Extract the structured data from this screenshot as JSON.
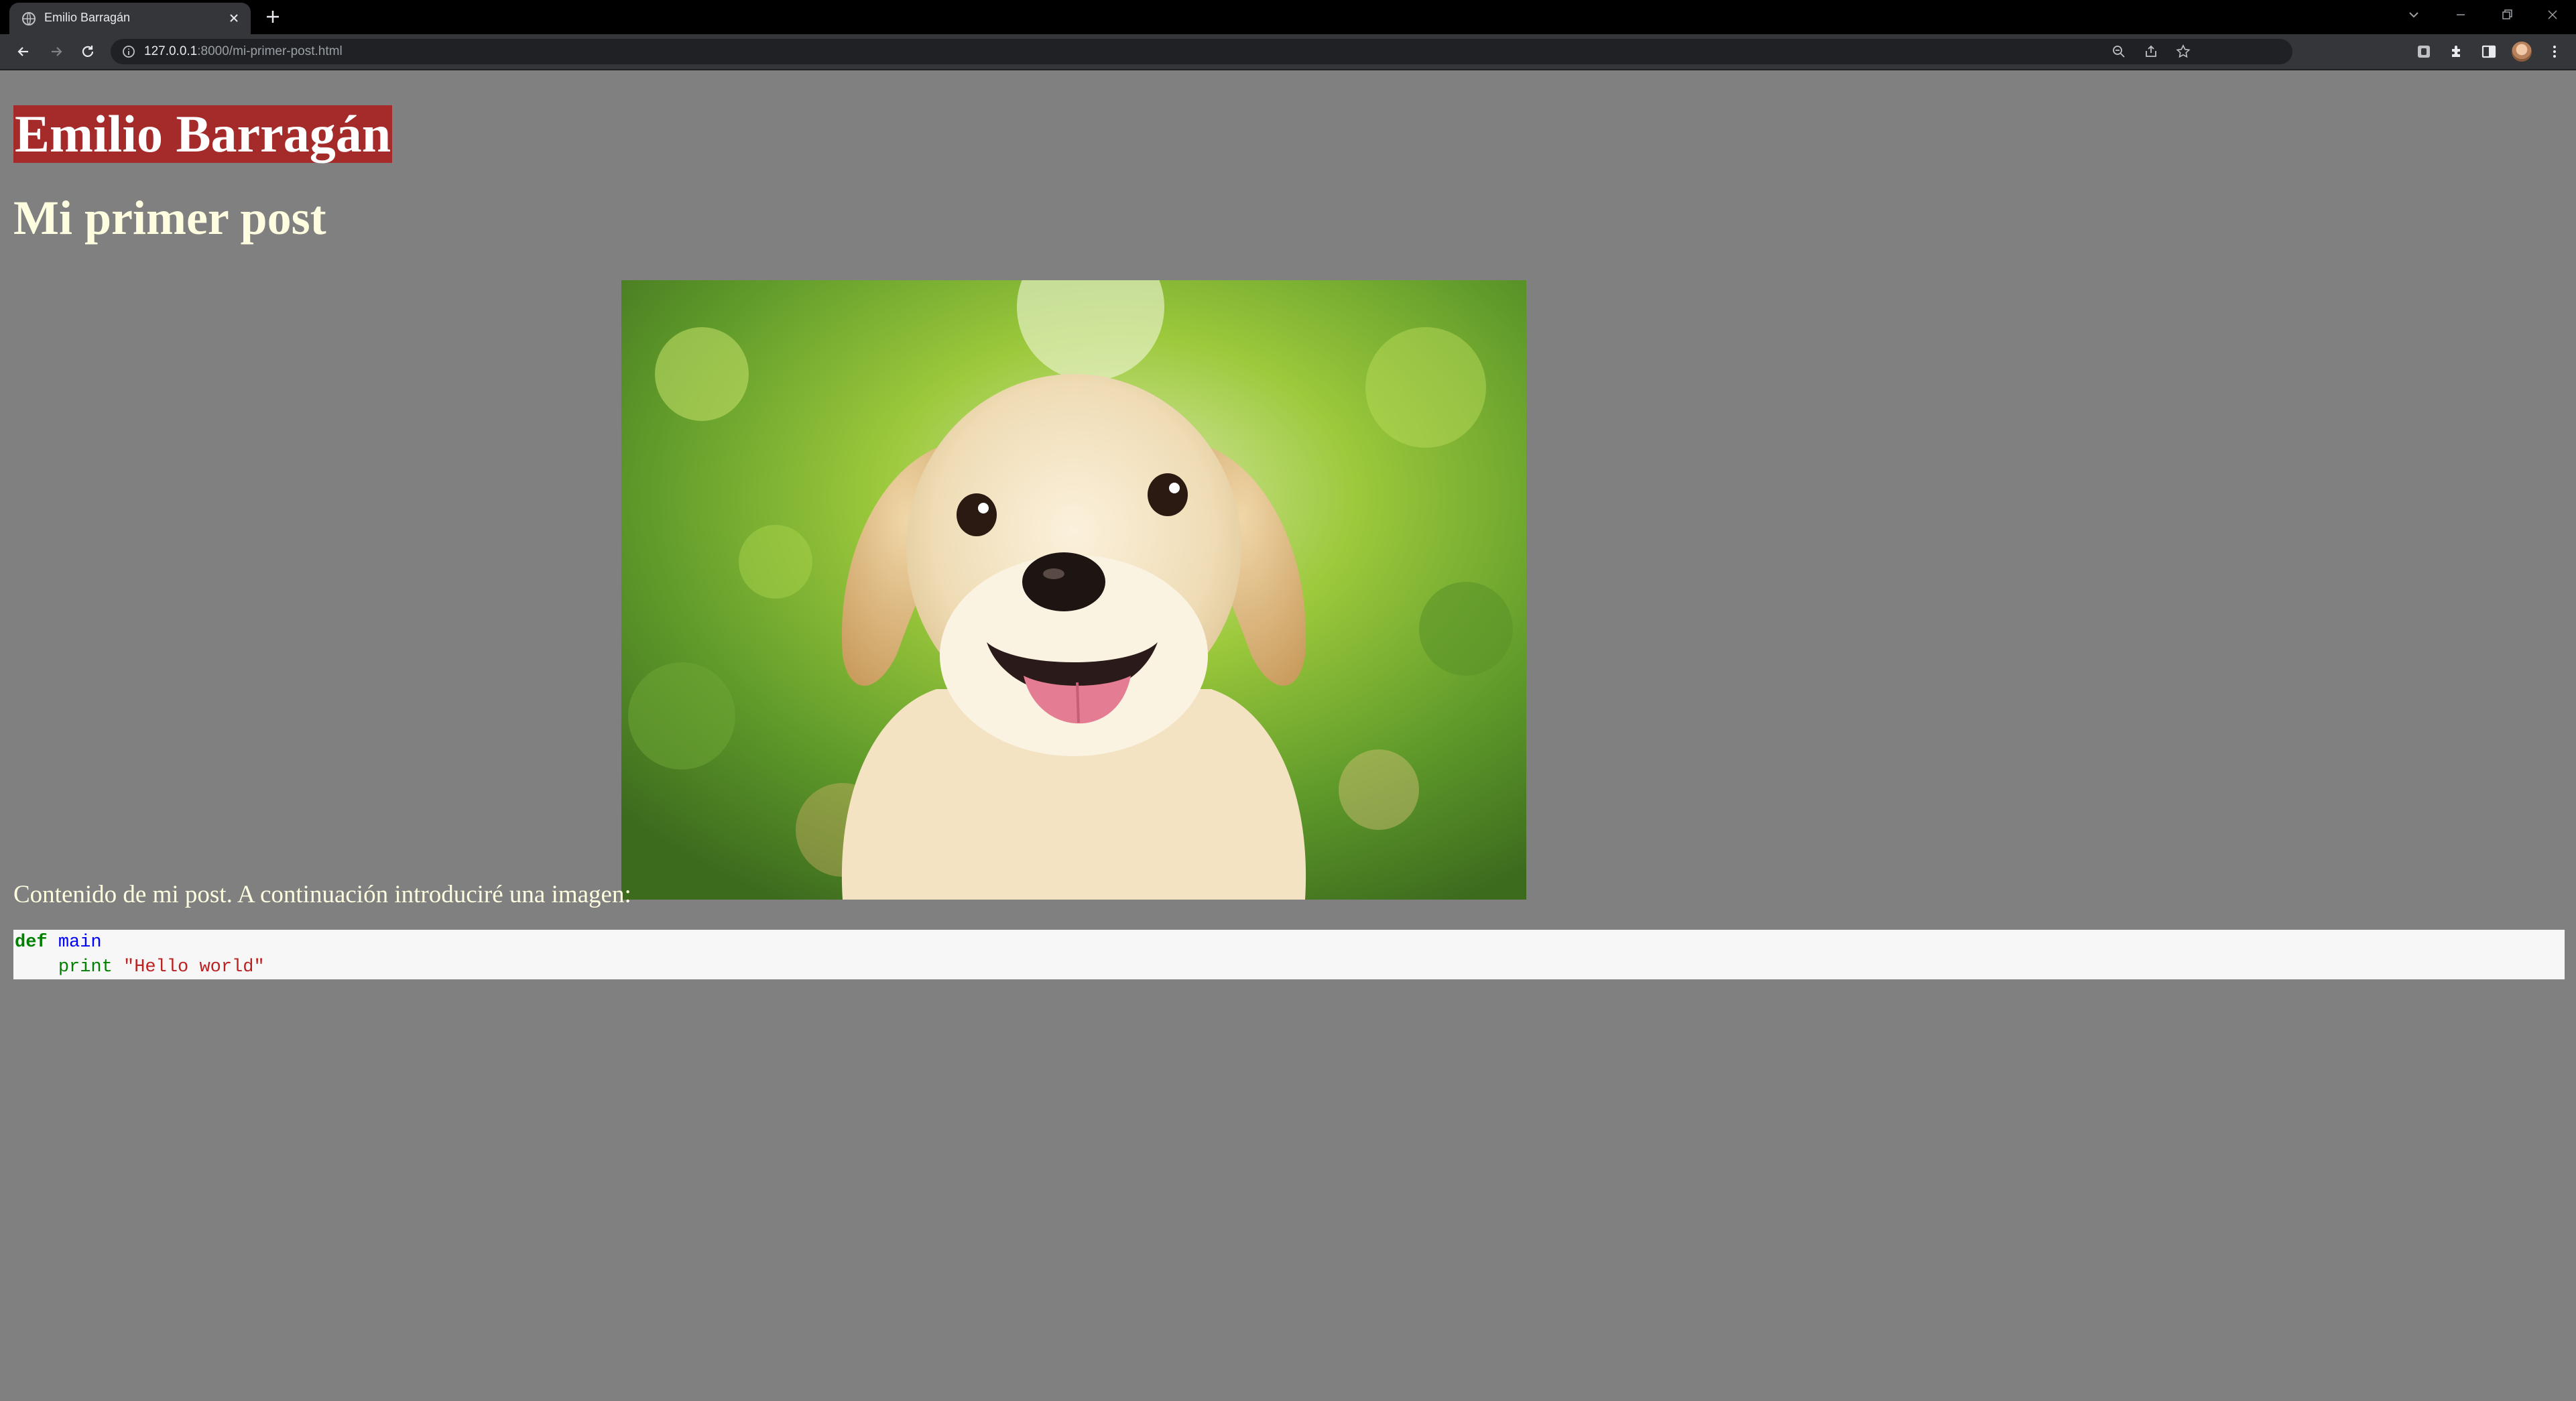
{
  "browser": {
    "tab_title": "Emilio Barragán",
    "url_host": "127.0.0.1",
    "url_rest": ":8000/mi-primer-post.html"
  },
  "page": {
    "site_title": "Emilio Barragán",
    "post_title": "Mi primer post",
    "post_text": "Contenido de mi post. A continuación introduciré una imagen:",
    "image_subject": "smiling yellow labrador puppy in front of green foliage",
    "code": {
      "line1_keyword": "def",
      "line1_name": "main",
      "line2_indent": "    ",
      "line2_builtin": "print",
      "line2_space": " ",
      "line2_string": "\"Hello world\""
    }
  },
  "colors": {
    "page_background": "#808080",
    "site_title_background": "#a52a2a",
    "post_title_color": "#fffde0",
    "code_background": "#f7f7f7"
  }
}
